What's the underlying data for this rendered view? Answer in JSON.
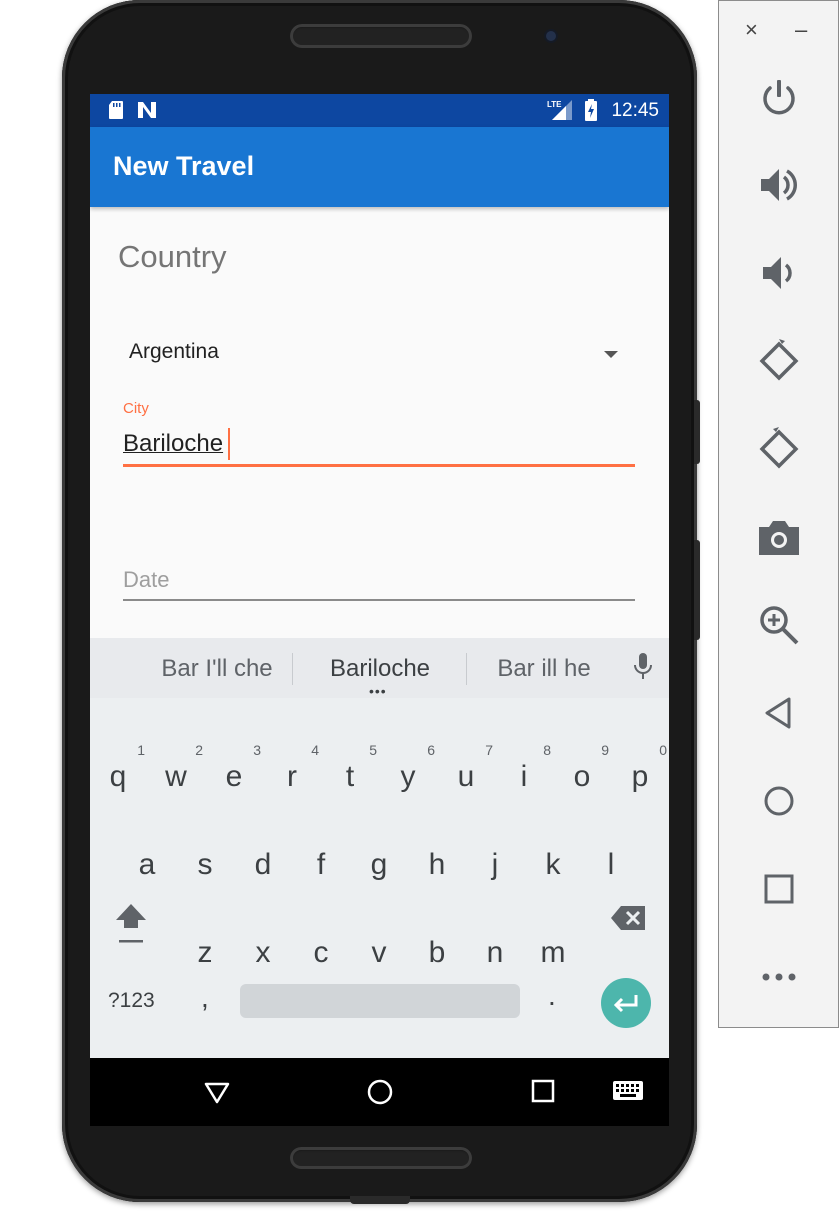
{
  "statusbar": {
    "time": "12:45",
    "network_label": "LTE"
  },
  "toolbar": {
    "title": "New Travel"
  },
  "form": {
    "country_label": "Country",
    "country_selected": "Argentina",
    "city_label": "City",
    "city_value": "Bariloche",
    "date_hint": "Date"
  },
  "keyboard": {
    "suggestions": [
      "Bar I'll che",
      "Bariloche",
      "Bar ill he"
    ],
    "row1": [
      {
        "ch": "q",
        "num": "1"
      },
      {
        "ch": "w",
        "num": "2"
      },
      {
        "ch": "e",
        "num": "3"
      },
      {
        "ch": "r",
        "num": "4"
      },
      {
        "ch": "t",
        "num": "5"
      },
      {
        "ch": "y",
        "num": "6"
      },
      {
        "ch": "u",
        "num": "7"
      },
      {
        "ch": "i",
        "num": "8"
      },
      {
        "ch": "o",
        "num": "9"
      },
      {
        "ch": "p",
        "num": "0"
      }
    ],
    "row2": [
      "a",
      "s",
      "d",
      "f",
      "g",
      "h",
      "j",
      "k",
      "l"
    ],
    "row3": [
      "z",
      "x",
      "c",
      "v",
      "b",
      "n",
      "m"
    ],
    "symbols_label": "?123",
    "comma": ",",
    "period": "."
  },
  "colors": {
    "status_bar": "#0d47a1",
    "toolbar": "#1976d2",
    "accent": "#ff7043",
    "enter_key": "#4db6ac"
  },
  "emulator_panel": {
    "close": "×",
    "minimize": "–",
    "buttons": [
      "power-icon",
      "volume-up-icon",
      "volume-down-icon",
      "rotate-left-icon",
      "rotate-right-icon",
      "camera-icon",
      "zoom-icon",
      "back-icon",
      "home-icon",
      "overview-icon",
      "more-icon"
    ]
  }
}
